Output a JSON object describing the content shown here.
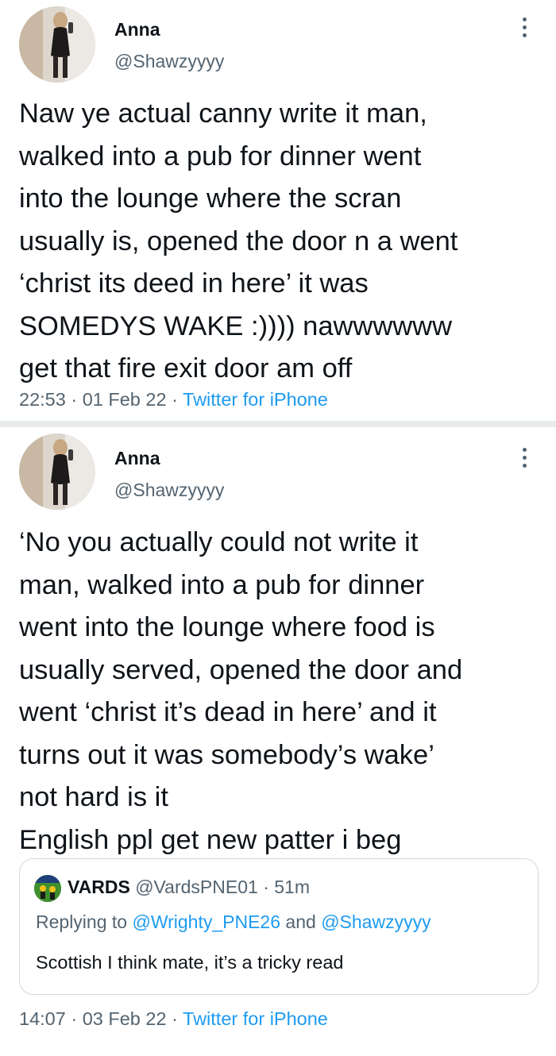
{
  "tweets": [
    {
      "author": {
        "name": "Anna",
        "handle": "@Shawzyyyy"
      },
      "text": "Naw ye actual canny write it man,\nwalked into a pub for dinner went\ninto the lounge where the scran\nusually is, opened the door n a went\n‘christ its deed in here’ it was\nSOMEDYS WAKE :)))) nawwwwww\nget that fire exit door am off",
      "time": "22:53",
      "sep1": " · ",
      "date": "01 Feb 22",
      "sep2": " · ",
      "source": "Twitter for iPhone"
    },
    {
      "author": {
        "name": "Anna",
        "handle": "@Shawzyyyy"
      },
      "text": "‘No you actually could not write it\nman, walked into a pub for dinner\nwent into the lounge where food is\nusually served, opened the door and\nwent ‘christ it’s dead in here’ and it\nturns out it was somebody’s wake’\nnot hard is it\nEnglish ppl get new patter i beg",
      "quote": {
        "name": "VARDS",
        "handle": "@VardsPNE01",
        "sep": " · ",
        "age": "51m",
        "replying_prefix": "Replying to ",
        "mention1": "@Wrighty_PNE26",
        "and": " and ",
        "mention2": "@Shawzyyyy",
        "text": "Scottish I think mate, it’s a tricky read"
      },
      "time": "14:07",
      "sep1": " · ",
      "date": "03 Feb 22",
      "sep2": " · ",
      "source": "Twitter for iPhone"
    }
  ],
  "colors": {
    "text": "#0f1419",
    "secondary": "#536471",
    "link": "#1d9bf0",
    "border": "#cfd9de",
    "divider": "#e9ecee"
  },
  "icons": [
    "profile-photo",
    "more-options-icon",
    "quote-avatar"
  ]
}
